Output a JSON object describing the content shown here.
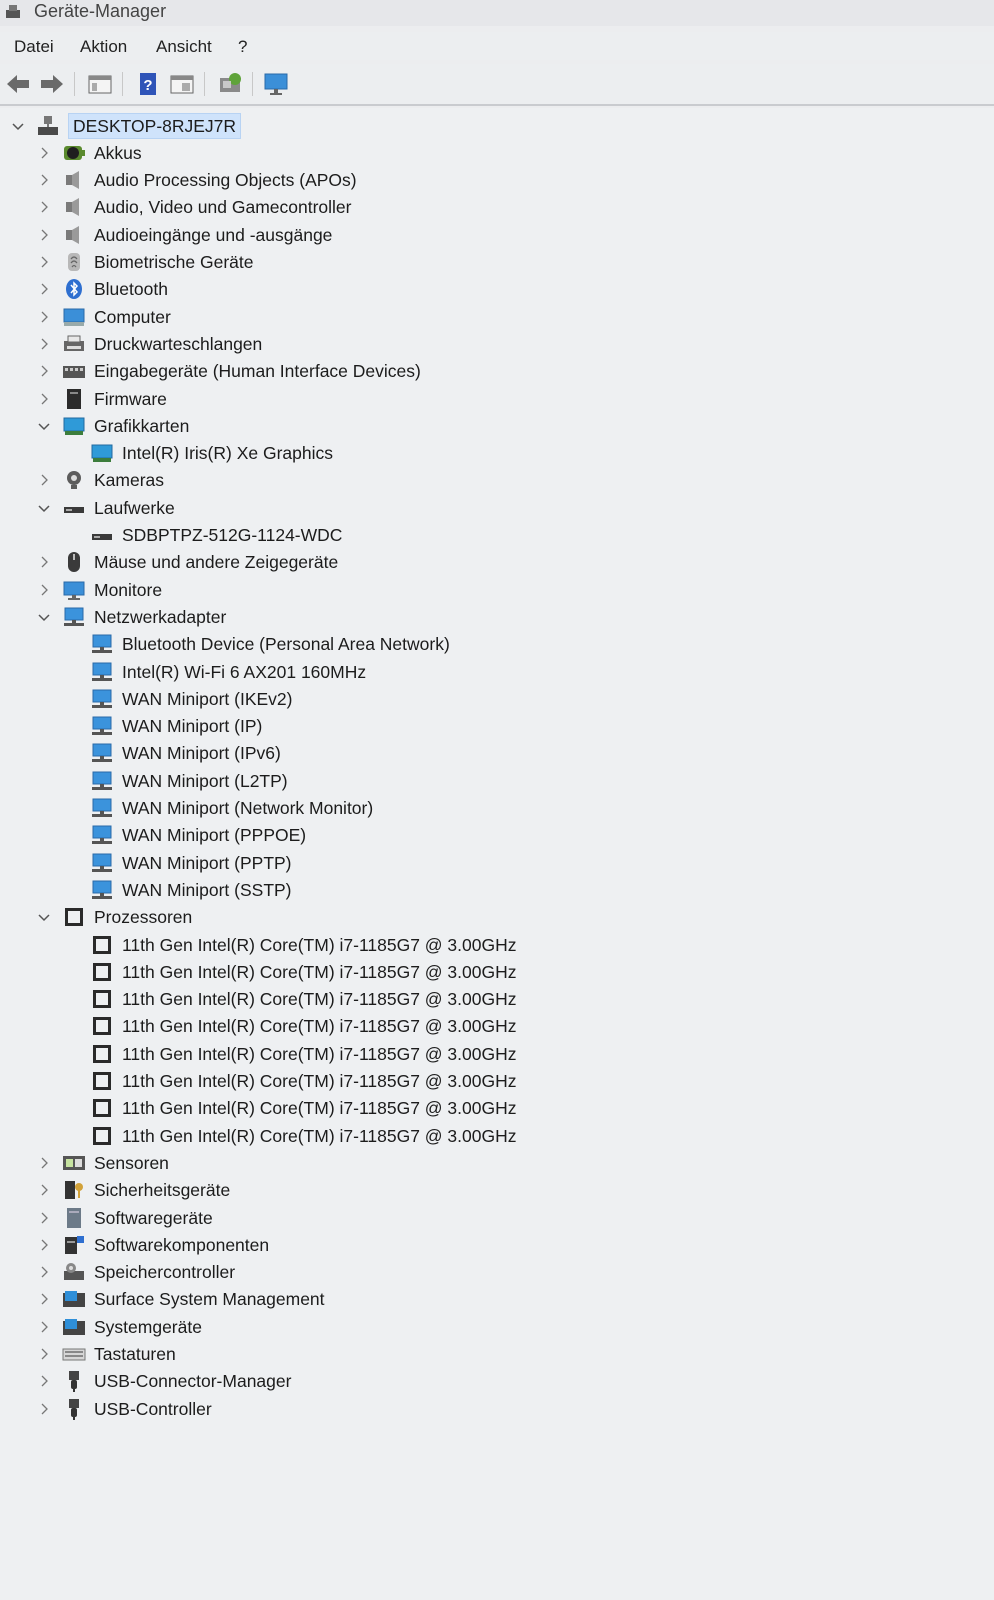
{
  "window": {
    "title": "Geräte-Manager"
  },
  "menu": [
    "Datei",
    "Aktion",
    "Ansicht",
    "?"
  ],
  "toolbar": [
    "back-arrow-icon",
    "forward-arrow-icon",
    "properties-window-icon",
    "help-icon",
    "console-tree-icon",
    "scan-hardware-icon",
    "monitor-icon"
  ],
  "tree": {
    "root": "DESKTOP-8RJEJ7R",
    "categories": [
      {
        "label": "Akkus",
        "icon": "battery-icon",
        "expanded": false
      },
      {
        "label": "Audio Processing Objects (APOs)",
        "icon": "speaker-icon",
        "expanded": false
      },
      {
        "label": "Audio, Video und Gamecontroller",
        "icon": "speaker-icon",
        "expanded": false
      },
      {
        "label": "Audioeingänge und -ausgänge",
        "icon": "speaker-icon",
        "expanded": false
      },
      {
        "label": "Biometrische Geräte",
        "icon": "fingerprint-icon",
        "expanded": false
      },
      {
        "label": "Bluetooth",
        "icon": "bluetooth-icon",
        "expanded": false
      },
      {
        "label": "Computer",
        "icon": "computer-icon",
        "expanded": false
      },
      {
        "label": "Druckwarteschlangen",
        "icon": "printer-icon",
        "expanded": false
      },
      {
        "label": "Eingabegeräte (Human Interface Devices)",
        "icon": "hid-icon",
        "expanded": false
      },
      {
        "label": "Firmware",
        "icon": "firmware-icon",
        "expanded": false
      },
      {
        "label": "Grafikkarten",
        "icon": "display-adapter-icon",
        "expanded": true,
        "children": [
          "Intel(R) Iris(R) Xe Graphics"
        ]
      },
      {
        "label": "Kameras",
        "icon": "camera-icon",
        "expanded": false
      },
      {
        "label": "Laufwerke",
        "icon": "drive-icon",
        "expanded": true,
        "children": [
          "SDBPTPZ-512G-1124-WDC"
        ]
      },
      {
        "label": "Mäuse und andere Zeigegeräte",
        "icon": "mouse-icon",
        "expanded": false
      },
      {
        "label": "Monitore",
        "icon": "monitor-icon",
        "expanded": false
      },
      {
        "label": "Netzwerkadapter",
        "icon": "network-adapter-icon",
        "expanded": true,
        "children": [
          "Bluetooth Device (Personal Area Network)",
          "Intel(R) Wi-Fi 6 AX201 160MHz",
          "WAN Miniport (IKEv2)",
          "WAN Miniport (IP)",
          "WAN Miniport (IPv6)",
          "WAN Miniport (L2TP)",
          "WAN Miniport (Network Monitor)",
          "WAN Miniport (PPPOE)",
          "WAN Miniport (PPTP)",
          "WAN Miniport (SSTP)"
        ]
      },
      {
        "label": "Prozessoren",
        "icon": "processor-icon",
        "expanded": true,
        "children": [
          "11th Gen Intel(R) Core(TM) i7-1185G7 @ 3.00GHz",
          "11th Gen Intel(R) Core(TM) i7-1185G7 @ 3.00GHz",
          "11th Gen Intel(R) Core(TM) i7-1185G7 @ 3.00GHz",
          "11th Gen Intel(R) Core(TM) i7-1185G7 @ 3.00GHz",
          "11th Gen Intel(R) Core(TM) i7-1185G7 @ 3.00GHz",
          "11th Gen Intel(R) Core(TM) i7-1185G7 @ 3.00GHz",
          "11th Gen Intel(R) Core(TM) i7-1185G7 @ 3.00GHz",
          "11th Gen Intel(R) Core(TM) i7-1185G7 @ 3.00GHz"
        ]
      },
      {
        "label": "Sensoren",
        "icon": "sensor-icon",
        "expanded": false
      },
      {
        "label": "Sicherheitsgeräte",
        "icon": "security-device-icon",
        "expanded": false
      },
      {
        "label": "Softwaregeräte",
        "icon": "software-device-icon",
        "expanded": false
      },
      {
        "label": "Softwarekomponenten",
        "icon": "software-component-icon",
        "expanded": false
      },
      {
        "label": "Speichercontroller",
        "icon": "storage-controller-icon",
        "expanded": false
      },
      {
        "label": "Surface System Management",
        "icon": "system-folder-icon",
        "expanded": false
      },
      {
        "label": "Systemgeräte",
        "icon": "system-folder-icon",
        "expanded": false
      },
      {
        "label": "Tastaturen",
        "icon": "keyboard-icon",
        "expanded": false
      },
      {
        "label": "USB-Connector-Manager",
        "icon": "usb-icon",
        "expanded": false
      },
      {
        "label": "USB-Controller",
        "icon": "usb-icon",
        "expanded": false
      }
    ]
  },
  "colors": {
    "selection": "#cfe3fb",
    "background": "#eef0f2",
    "accent": "#2a7fd4"
  }
}
